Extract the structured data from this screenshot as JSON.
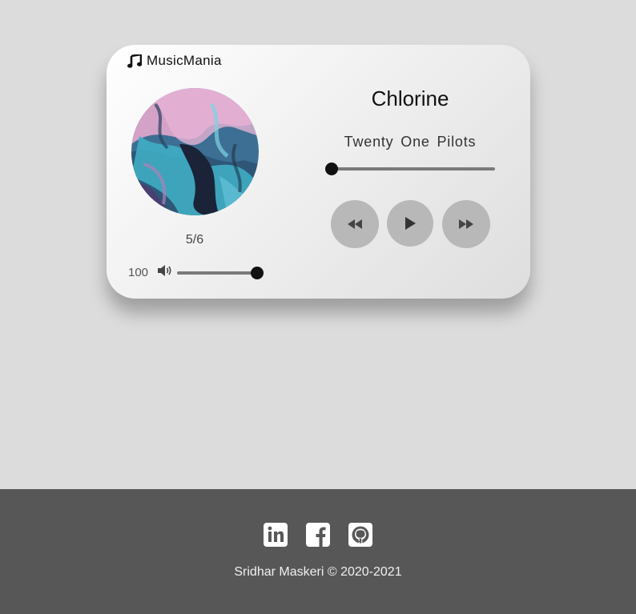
{
  "app": {
    "brand_name": "MusicMania",
    "brand_icon": "music-note-icon"
  },
  "player": {
    "song_title": "Chlorine",
    "artist": "Twenty One Pilots",
    "track_position": "5/6",
    "volume": {
      "value": "100",
      "level_percent": 100,
      "icon": "volume-icon"
    },
    "seek": {
      "progress_percent": 0
    },
    "controls": {
      "previous_icon": "rewind-icon",
      "play_icon": "play-icon",
      "next_icon": "fast-forward-icon"
    },
    "album_art_icon": "album-art"
  },
  "footer": {
    "social_icons": [
      "linkedin-icon",
      "facebook-icon",
      "github-icon"
    ],
    "copyright": "Sridhar Maskeri © 2020-2021"
  },
  "colors": {
    "page_background": "#dcdcdc",
    "footer_background": "#575757",
    "control_button": "#b8b8b8",
    "slider_track": "#7a7a7a",
    "slider_thumb": "#111111"
  }
}
